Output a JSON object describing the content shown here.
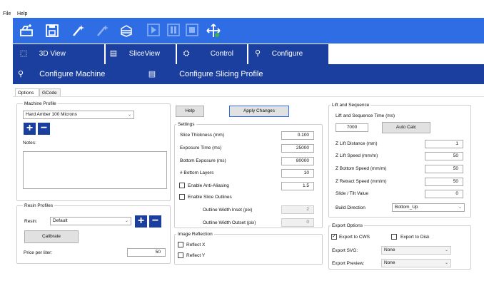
{
  "menu": {
    "file": "File",
    "help": "Help"
  },
  "toolbar": {
    "icons": [
      "open-stl-icon",
      "save-icon",
      "wand-icon",
      "wand-disabled-icon",
      "slice-cube-icon",
      "play-icon",
      "pause-icon",
      "stop-icon",
      "move-icon"
    ]
  },
  "main_tabs": [
    {
      "label": "3D View",
      "icon": "cube-3d-icon"
    },
    {
      "label": "SliceView",
      "icon": "slice-view-icon"
    },
    {
      "label": "Control",
      "icon": "control-icon"
    },
    {
      "label": "Configure",
      "icon": "configure-icon"
    }
  ],
  "config_tabs": [
    {
      "label": "Configure Machine",
      "icon": "machine-icon"
    },
    {
      "label": "Configure Slicing Profile",
      "icon": "slicing-profile-icon"
    }
  ],
  "sub_tabs": {
    "options": "Options",
    "gcode": "GCode"
  },
  "machine_profile": {
    "title": "Machine Profile",
    "selected": "Hard Amber 100 Microns",
    "notes_label": "Notes:"
  },
  "resin_profiles": {
    "title": "Resin Profiles",
    "resin_label": "Resin:",
    "resin_selected": "Default",
    "calibrate": "Calibrate",
    "price_label": "Price per liter:",
    "price_value": "50"
  },
  "actions": {
    "help": "Help",
    "apply": "Apply Changes"
  },
  "settings": {
    "title": "Settings",
    "slice_thickness_label": "Slice Thickness (mm)",
    "slice_thickness": "0.100",
    "exposure_label": "Exposure Time (ms)",
    "exposure": "25000",
    "bottom_exposure_label": "Bottom Exposure (ms)",
    "bottom_exposure": "80000",
    "bottom_layers_label": "# Bottom Layers",
    "bottom_layers": "10",
    "anti_aliasing_label": "Enable Anti-Aliasing",
    "anti_aliasing_value": "1.5",
    "slice_outlines_label": "Enable Slice Outlines",
    "inset_label": "Outline Width Inset (pix)",
    "inset": "2",
    "outset_label": "Outline Width Outset (pix)",
    "outset": "0"
  },
  "image_reflection": {
    "title": "Image Reflection",
    "reflect_x": "Reflect X",
    "reflect_y": "Reflect Y"
  },
  "lift": {
    "title": "Lift and Sequence",
    "time_label": "Lift and Sequence Time (ms)",
    "time_value": "7000",
    "auto_calc": "Auto Calc",
    "z_lift_distance_label": "Z Lift Distance (mm)",
    "z_lift_distance": "1",
    "z_lift_speed_label": "Z Lift Speed (mm/m)",
    "z_lift_speed": "50",
    "z_bottom_speed_label": "Z Bottom Speed (mm/m)",
    "z_bottom_speed": "50",
    "z_retract_speed_label": "Z Retract Speed (mm/m)",
    "z_retract_speed": "50",
    "slide_tilt_label": "Slide / Tilt Value",
    "slide_tilt": "0",
    "build_direction_label": "Build Direction",
    "build_direction": "Bottom_Up"
  },
  "export": {
    "title": "Export Options",
    "to_cws": "Export to CWS",
    "to_disk": "Export to Disk",
    "svg_label": "Export SVG:",
    "svg_value": "None",
    "preview_label": "Export Preview:",
    "preview_value": "None"
  },
  "colors": {
    "toolbar": "#2f6de5",
    "nav_dark": "#1b3f9e",
    "icon_green": "#3cb34a"
  }
}
